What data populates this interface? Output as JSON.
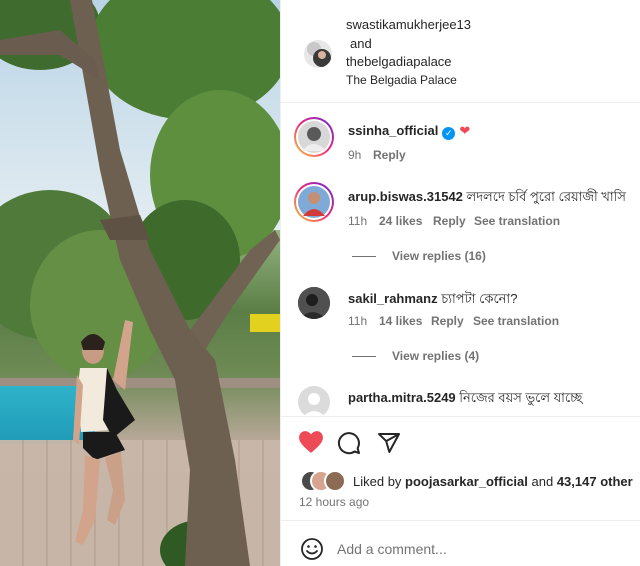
{
  "post": {
    "header": {
      "users": [
        "swastikamukherjee13",
        "and",
        "thebelgadiapalace"
      ],
      "location": "The Belgadia Palace"
    },
    "comments": [
      {
        "username": "ssinha_official",
        "text": "",
        "time": "9h",
        "likes": "",
        "reply_label": "Reply",
        "translation_label": "",
        "verified": true,
        "emoji": "heart"
      },
      {
        "username": "arup.biswas.31542",
        "text": "লদলদে চর্বি পুরো রেয়াজী খাসি",
        "time": "11h",
        "likes": "24 likes",
        "reply_label": "Reply",
        "translation_label": "See translation",
        "view_replies": "View replies (16)"
      },
      {
        "username": "sakil_rahmanz",
        "text": "চ্যাপটা কেনো?",
        "time": "11h",
        "likes": "14 likes",
        "reply_label": "Reply",
        "translation_label": "See translation",
        "view_replies": "View replies (4)"
      },
      {
        "username": "partha.mitra.5249",
        "text": "নিজের বয়স ভুলে যাচ্ছে"
      }
    ],
    "actions": {
      "like_icon": "heart-icon",
      "comment_icon": "comment-icon",
      "share_icon": "share-icon"
    },
    "likes_summary": {
      "prefix": "Liked by",
      "user": "poojasarkar_official",
      "conj": "and",
      "count": "43,147 other"
    },
    "timestamp": "12 hours ago",
    "add_comment": {
      "placeholder": "Add a comment...",
      "emoji_icon": "emoji-icon"
    },
    "colors": {
      "like_red": "#ed4956",
      "verified_blue": "#0095f6",
      "text_gray": "#737373"
    }
  }
}
